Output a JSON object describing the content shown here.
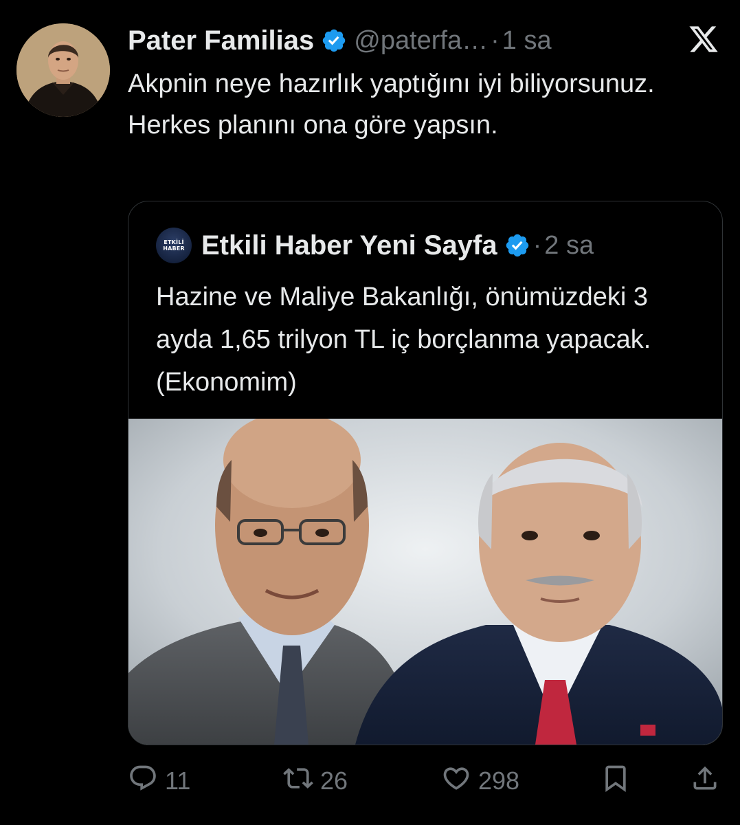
{
  "tweet": {
    "author": {
      "name": "Pater Familias",
      "handle": "@paterfa…",
      "verified": true
    },
    "separator": "·",
    "time": "1 sa",
    "text": "Akpnin neye hazırlık yaptığını iyi biliyorsunuz. Herkes planını ona göre yapsın."
  },
  "quote": {
    "author": {
      "name": "Etkili Haber Yeni Sayfa",
      "avatar_text_line1": "ETKİLİ",
      "avatar_text_line2": "HABER",
      "verified": true
    },
    "separator": "·",
    "time": "2 sa",
    "text": "Hazine ve Maliye Bakanlığı, önümüzdeki 3 ayda 1,65 trilyon TL iç borçlanma yapacak. (Ekonomim)"
  },
  "actions": {
    "reply_count": "11",
    "repost_count": "26",
    "like_count": "298"
  },
  "icons": {
    "brand": "x-logo-icon",
    "verified": "verified-badge-icon",
    "reply": "reply-icon",
    "repost": "repost-icon",
    "like": "heart-icon",
    "bookmark": "bookmark-icon",
    "share": "share-icon"
  },
  "colors": {
    "background": "#000000",
    "text": "#e7e9ea",
    "secondary": "#71767b",
    "verified_blue": "#1d9bf0",
    "border": "#2f3336"
  }
}
